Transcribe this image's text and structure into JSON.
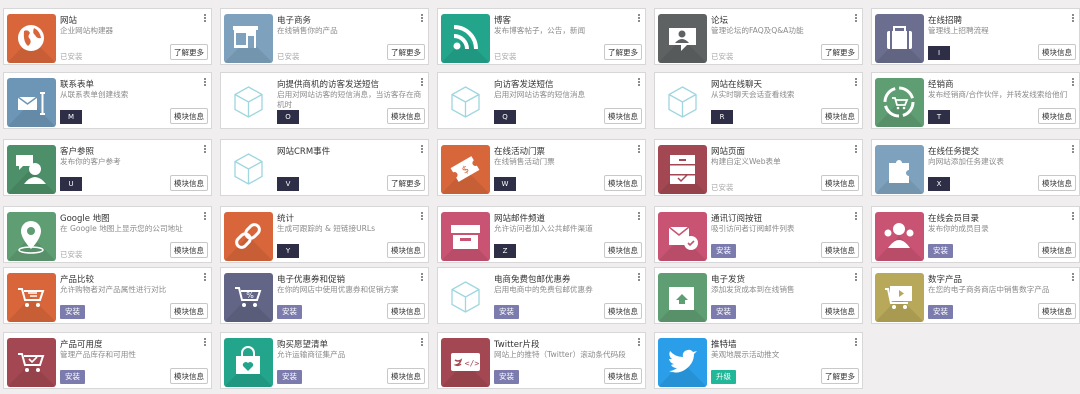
{
  "labels": {
    "installed": "已安装",
    "learn_more": "了解更多",
    "module_info": "模块信息",
    "install": "安装",
    "upgrade": "升级"
  },
  "apps": [
    {
      "title": "网站",
      "desc": "企业网站构建器",
      "state": "installed",
      "action": "learn_more",
      "icon": "globe-icon",
      "color": "#d9663b"
    },
    {
      "title": "电子商务",
      "desc": "在线销售你的产品",
      "state": "installed",
      "action": "learn_more",
      "icon": "shop-icon",
      "color": "#7ea2bd"
    },
    {
      "title": "博客",
      "desc": "发布博客帖子，公告，新闻",
      "state": "installed",
      "action": "learn_more",
      "icon": "rss-icon",
      "color": "#23a58c"
    },
    {
      "title": "论坛",
      "desc": "管理论坛的FAQ及Q&A功能",
      "state": "installed",
      "action": "learn_more",
      "icon": "chat-icon",
      "color": "#5f6263"
    },
    {
      "title": "在线招聘",
      "desc": "管理线上招聘流程",
      "state": "tech",
      "tech": "I",
      "action": "module_info",
      "icon": "briefcase-icon",
      "color": "#6b6e8e"
    },
    {
      "title": "联系表单",
      "desc": "从联系表单创建线索",
      "state": "tech",
      "tech": "M",
      "action": "module_info",
      "icon": "form-icon",
      "color": "#6d96b6"
    },
    {
      "title": "向提供商机的访客发送短信",
      "desc": "启用对网站访客的短信消息，当访客存在商机时",
      "state": "tech",
      "tech": "O",
      "action": "module_info",
      "icon": "cube-icon",
      "color": ""
    },
    {
      "title": "向访客发送短信",
      "desc": "启用对网站访客的短信消息",
      "state": "tech",
      "tech": "Q",
      "action": "module_info",
      "icon": "cube-icon",
      "color": ""
    },
    {
      "title": "网站在线聊天",
      "desc": "从实时聊天会话查看线索",
      "state": "tech",
      "tech": "R",
      "action": "module_info",
      "icon": "cube-icon",
      "color": ""
    },
    {
      "title": "经销商",
      "desc": "发布经销商/合作伙伴，并转发线索给他们",
      "state": "tech",
      "tech": "T",
      "action": "module_info",
      "icon": "recycle-cart-icon",
      "color": "#5f9d72"
    },
    {
      "title": "客户参照",
      "desc": "发布你的客户参考",
      "state": "tech",
      "tech": "U",
      "action": "module_info",
      "icon": "user-chat-icon",
      "color": "#4c8f68"
    },
    {
      "title": "网站CRM事件",
      "desc": "",
      "state": "tech",
      "tech": "V",
      "action": "learn_more",
      "icon": "cube-icon",
      "color": ""
    },
    {
      "title": "在线活动门票",
      "desc": "在线销售活动门票",
      "state": "tech",
      "tech": "W",
      "action": "module_info",
      "icon": "ticket-icon",
      "color": "#d7663b"
    },
    {
      "title": "网站页面",
      "desc": "构建自定义Web表单",
      "state": "installed",
      "action": "module_info",
      "icon": "cabinet-icon",
      "color": "#a34852"
    },
    {
      "title": "在线任务提交",
      "desc": "向网站添加任务建议表",
      "state": "tech",
      "tech": "X",
      "action": "module_info",
      "icon": "puzzle-icon",
      "color": "#7ea2bd"
    },
    {
      "title": "Google 地图",
      "desc": "在 Google 地图上显示您的公司地址",
      "state": "installed",
      "action": "module_info",
      "icon": "map-pin-icon",
      "color": "#5f9d72"
    },
    {
      "title": "统计",
      "desc": "生成可跟踪的 & 短链接URLs",
      "state": "tech",
      "tech": "Y",
      "action": "module_info",
      "icon": "link-icon",
      "color": "#d9663b"
    },
    {
      "title": "网站邮件频道",
      "desc": "允许访问者加入公共邮件渠道",
      "state": "tech",
      "tech": "Z",
      "action": "module_info",
      "icon": "inbox-icon",
      "color": "#c85372"
    },
    {
      "title": "通讯订阅按钮",
      "desc": "吸引访问者订阅邮件列表",
      "state": "install",
      "action": "module_info",
      "icon": "subscribe-icon",
      "color": "#c85372"
    },
    {
      "title": "在线会员目录",
      "desc": "发布你的成员目录",
      "state": "install",
      "action": "module_info",
      "icon": "members-icon",
      "color": "#c85372"
    },
    {
      "title": "产品比较",
      "desc": "允许购物者对产品属性进行对比",
      "state": "install",
      "action": "module_info",
      "icon": "compare-cart-icon",
      "color": "#d9663b"
    },
    {
      "title": "电子优惠券和促销",
      "desc": "在你的网店中使用优惠券和促销方案",
      "state": "install",
      "action": "module_info",
      "icon": "coupon-cart-icon",
      "color": "#626585"
    },
    {
      "title": "电商免费包邮优惠券",
      "desc": "启用电商中的免费包邮优惠券",
      "state": "install",
      "action": "module_info",
      "icon": "cube-icon",
      "color": ""
    },
    {
      "title": "电子发货",
      "desc": "添加发货成本到在线销售",
      "state": "install",
      "action": "module_info",
      "icon": "delivery-icon",
      "color": "#5f9d72"
    },
    {
      "title": "数字产品",
      "desc": "在您的电子商务商店中销售数字产品",
      "state": "install",
      "action": "module_info",
      "icon": "digital-cart-icon",
      "color": "#b8a85a"
    },
    {
      "title": "产品可用度",
      "desc": "管理产品库存和可用性",
      "state": "install",
      "action": "module_info",
      "icon": "stock-cart-icon",
      "color": "#a34852"
    },
    {
      "title": "购买愿望清单",
      "desc": "允许运输商征集产品",
      "state": "install",
      "action": "module_info",
      "icon": "wishlist-icon",
      "color": "#23a58c"
    },
    {
      "title": "Twitter片段",
      "desc": "网站上的推特（Twitter）滚动条代码段",
      "state": "install",
      "action": "module_info",
      "icon": "tweet-code-icon",
      "color": "#a34852"
    },
    {
      "title": "推特墙",
      "desc": "美观地展示活动推文",
      "state": "upgrade",
      "action": "learn_more",
      "icon": "twitter-bird-icon",
      "color": "#2a9ee8"
    }
  ]
}
